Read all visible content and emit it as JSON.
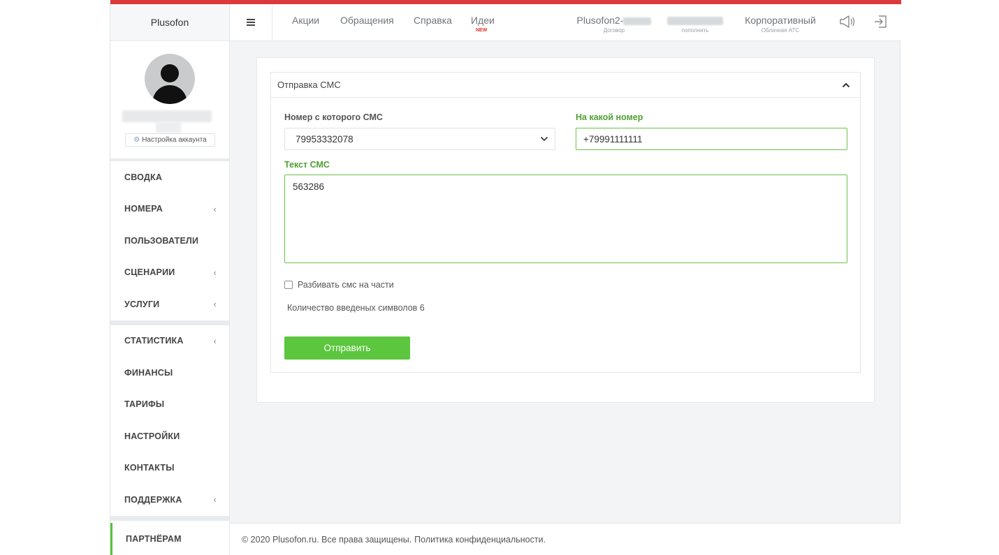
{
  "brand": {
    "name": "Plusofon"
  },
  "topbar": {
    "nav": [
      {
        "label": "Акции"
      },
      {
        "label": "Обращения"
      },
      {
        "label": "Справка"
      },
      {
        "label": "Идеи",
        "badge": "NEW"
      }
    ],
    "contract": {
      "main": "Plusofon2-",
      "sub": "Договор"
    },
    "balance": {
      "sub": "пополнить"
    },
    "plan": {
      "main": "Корпоративный",
      "sub": "Облачная АТС"
    },
    "icons": [
      "megaphone-icon",
      "logout-icon"
    ]
  },
  "sidebar": {
    "account_settings": "Настройка аккаунта",
    "groups": [
      [
        {
          "label": "СВОДКА",
          "chevron": false
        },
        {
          "label": "НОМЕРА",
          "chevron": true
        },
        {
          "label": "ПОЛЬЗОВАТЕЛИ",
          "chevron": false
        },
        {
          "label": "СЦЕНАРИИ",
          "chevron": true
        },
        {
          "label": "УСЛУГИ",
          "chevron": true
        }
      ],
      [
        {
          "label": "СТАТИСТИКА",
          "chevron": true
        },
        {
          "label": "ФИНАНСЫ",
          "chevron": false
        },
        {
          "label": "ТАРИФЫ",
          "chevron": false
        },
        {
          "label": "НАСТРОЙКИ",
          "chevron": false
        },
        {
          "label": "КОНТАКТЫ",
          "chevron": false
        },
        {
          "label": "ПОДДЕРЖКА",
          "chevron": true
        }
      ]
    ],
    "partners": "ПАРТНЁРАМ",
    "chevron_glyph": "‹"
  },
  "sms_form": {
    "title": "Отправка СМС",
    "from_label": "Номер с которого СМС",
    "from_value": "79953332078",
    "to_label": "На какой номер",
    "to_value": "+79991111111",
    "text_label": "Текст СМС",
    "text_value": "563286",
    "split_label": "Разбивать смс на части",
    "split_checked": false,
    "count_text": "Количество введеных символов 6",
    "send_label": "Отправить"
  },
  "footer": {
    "copyright": "© 2020 Plusofon.ru. Все права защищены.",
    "privacy": "Политика конфиденциальности."
  },
  "colors": {
    "top_accent": "#dc3a3a",
    "success": "#5bc63e",
    "label_green": "#4ea032",
    "new_badge": "#e0302a"
  }
}
